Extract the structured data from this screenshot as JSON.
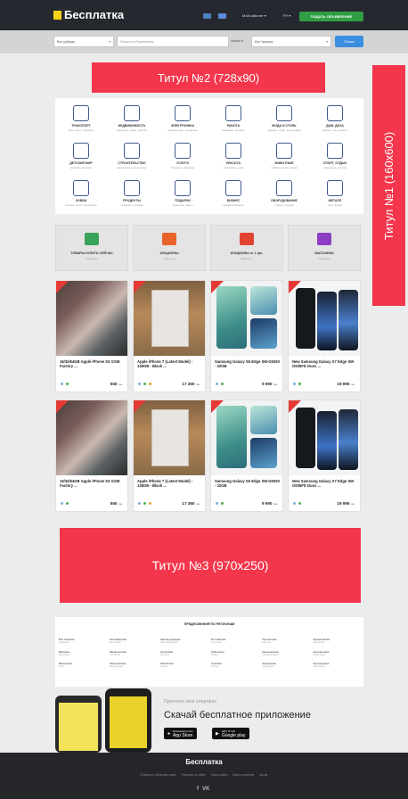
{
  "header": {
    "logo": "Бесплатка",
    "cabinet": "Мой кабинет ▾",
    "lang": "РУ ▾",
    "post_button": "ПОДАТЬ ОБЪЯВЛЕНИЕ",
    "icon_colors": [
      "#4f7fbf",
      "#5a8ed6"
    ]
  },
  "search": {
    "category": "Все рубрики",
    "placeholder": "Поиск по объявлениям",
    "where": "Искать в",
    "region": "Вся Украина",
    "button": "Поиск"
  },
  "banners": {
    "title2": "Титул №2 (728x90)",
    "title1": "Титул №1 (160x600)",
    "title3": "Титул №3 (970x250)"
  },
  "categories": [
    {
      "name": "Транспорт",
      "sub": "авто, мото, запчасти",
      "icon": "bus-icon"
    },
    {
      "name": "Недвижимость",
      "sub": "квартиры, дома, участки",
      "icon": "keys-icon"
    },
    {
      "name": "Электроника",
      "sub": "компьютеры, телефоны",
      "icon": "monitor-icon"
    },
    {
      "name": "Работа",
      "sub": "вакансии, резюме",
      "icon": "briefcase-icon"
    },
    {
      "name": "Мода и стиль",
      "sub": "одежда, обувь, аксессуары",
      "icon": "dress-icon"
    },
    {
      "name": "Дом, дача",
      "sub": "мебель, сад, ремонт",
      "icon": "sofa-icon"
    },
    {
      "name": "Детский мир",
      "sub": "коляски, игрушки",
      "icon": "stroller-icon"
    },
    {
      "name": "Строительство",
      "sub": "материалы, инструмент",
      "icon": "tools-icon"
    },
    {
      "name": "Услуги",
      "sub": "бытовые, деловые",
      "icon": "broom-icon"
    },
    {
      "name": "Красота",
      "sub": "косметика, уход",
      "icon": "lipstick-icon"
    },
    {
      "name": "Животные",
      "sub": "собаки, кошки, корма",
      "icon": "dog-icon"
    },
    {
      "name": "Спорт, отдых",
      "sub": "инвентарь, туризм",
      "icon": "bicycle-icon"
    },
    {
      "name": "Хобби",
      "sub": "музыка, книги, коллекции",
      "icon": "guitar-icon"
    },
    {
      "name": "Продукты",
      "sub": "продукты питания",
      "icon": "bottle-icon"
    },
    {
      "name": "Подарки",
      "sub": "сувениры, цветы",
      "icon": "gift-icon"
    },
    {
      "name": "Бизнес",
      "sub": "продажа бизнеса",
      "icon": "bag-icon"
    },
    {
      "name": "Оборудование",
      "sub": "станки, техника",
      "icon": "machine-icon"
    },
    {
      "name": "Металл",
      "sub": "лом, прокат",
      "icon": "metal-icon"
    }
  ],
  "features": [
    {
      "name": "ТОВАРЫ КУПИТЬ СЕЙЧАС",
      "sub": "Смотреть",
      "icon": "basket-icon",
      "color": "#3aa35a"
    },
    {
      "name": "АУКЦИОНЫ",
      "sub": "Смотреть",
      "icon": "hammer-icon",
      "color": "#e8632a"
    },
    {
      "name": "АУКЦИОНЫ от 1 грн.",
      "sub": "Смотреть",
      "icon": "money-icon",
      "color": "#e0442f"
    },
    {
      "name": "МАГАЗИНЫ",
      "sub": "Смотреть",
      "icon": "cart-icon",
      "color": "#8d3fc4"
    }
  ],
  "products_row1": [
    {
      "title": "16/32/64GB Apple iPhone 5S GSM Factory ...",
      "price": "550",
      "currency": "грн.",
      "image": "motorcycle"
    },
    {
      "title": "Apple iPhone 7 (Latest Model) - 128GB - Black ...",
      "price": "17 360",
      "currency": "грн.",
      "image": "box"
    },
    {
      "title": "Samsung Galaxy S6 Edge SM-G925V - 32GB",
      "price": "9 990",
      "currency": "грн.",
      "image": "s6"
    },
    {
      "title": "New Samsung Galaxy S7 Edge SM-G935FD Duos ...",
      "price": "19 990",
      "currency": "грн.",
      "image": "s7"
    }
  ],
  "products_row2": [
    {
      "title": "16/32/64GB Apple iPhone 5S GSM Factory ...",
      "price": "550",
      "currency": "грн.",
      "image": "motorcycle"
    },
    {
      "title": "Apple iPhone 7 (Latest Model) - 128GB - Black ...",
      "price": "17 360",
      "currency": "грн.",
      "image": "box"
    },
    {
      "title": "Samsung Galaxy S6 Edge SM-G925V - 32GB",
      "price": "9 990",
      "currency": "грн.",
      "image": "s6"
    },
    {
      "title": "New Samsung Galaxy S7 Edge SM-G935FD Duos ...",
      "price": "19 990",
      "currency": "грн.",
      "image": "s7"
    }
  ],
  "regions": {
    "title": "ПРЕДЛОЖЕНИЯ ПО РЕГИОНАМ",
    "columns": [
      [
        {
          "city": "Вся Украина",
          "region": "Украина"
        },
        {
          "city": "Винница",
          "region": "Винница"
        },
        {
          "city": "Винницкая",
          "region": "Луцк"
        }
      ],
      [
        {
          "city": "Житомирская",
          "region": "Житомир"
        },
        {
          "city": "Закарпатская",
          "region": "Ужгород"
        },
        {
          "city": "Запорожская",
          "region": "Запорожье"
        }
      ],
      [
        {
          "city": "Кировоградская",
          "region": "Кропивницкий"
        },
        {
          "city": "Луганская",
          "region": "Луганск"
        },
        {
          "city": "Львовская",
          "region": "Львов"
        }
      ],
      [
        {
          "city": "Полтавская",
          "region": "Полтава"
        },
        {
          "city": "Ровенская",
          "region": "Ровно"
        },
        {
          "city": "Сумская",
          "region": "Сумы"
        }
      ],
      [
        {
          "city": "Херсонская",
          "region": "Херсон"
        },
        {
          "city": "Хмельницкая",
          "region": "Хмельницкий"
        },
        {
          "city": "Черкасская",
          "region": "Черкассы"
        }
      ],
      [
        {
          "city": "Черниговская",
          "region": "Чернигов"
        },
        {
          "city": "Черновицкая",
          "region": "Черновцы"
        },
        {
          "city": "Черновицкая",
          "region": "Черновцы"
        }
      ]
    ]
  },
  "promo": {
    "subtitle": "Приятная своё смартфон",
    "title": "Скачай бесплатное приложение",
    "appstore_top": "Download on the",
    "appstore": "App Store",
    "googleplay_top": "GET IT ON",
    "googleplay": "Google play"
  },
  "footer": {
    "logo": "Бесплатка",
    "links": [
      "Помощь и обратная связь",
      "Реклама на сайте",
      "Карта сайта",
      "Карта регионов",
      "Архив"
    ],
    "social": [
      "f",
      "VK"
    ]
  }
}
